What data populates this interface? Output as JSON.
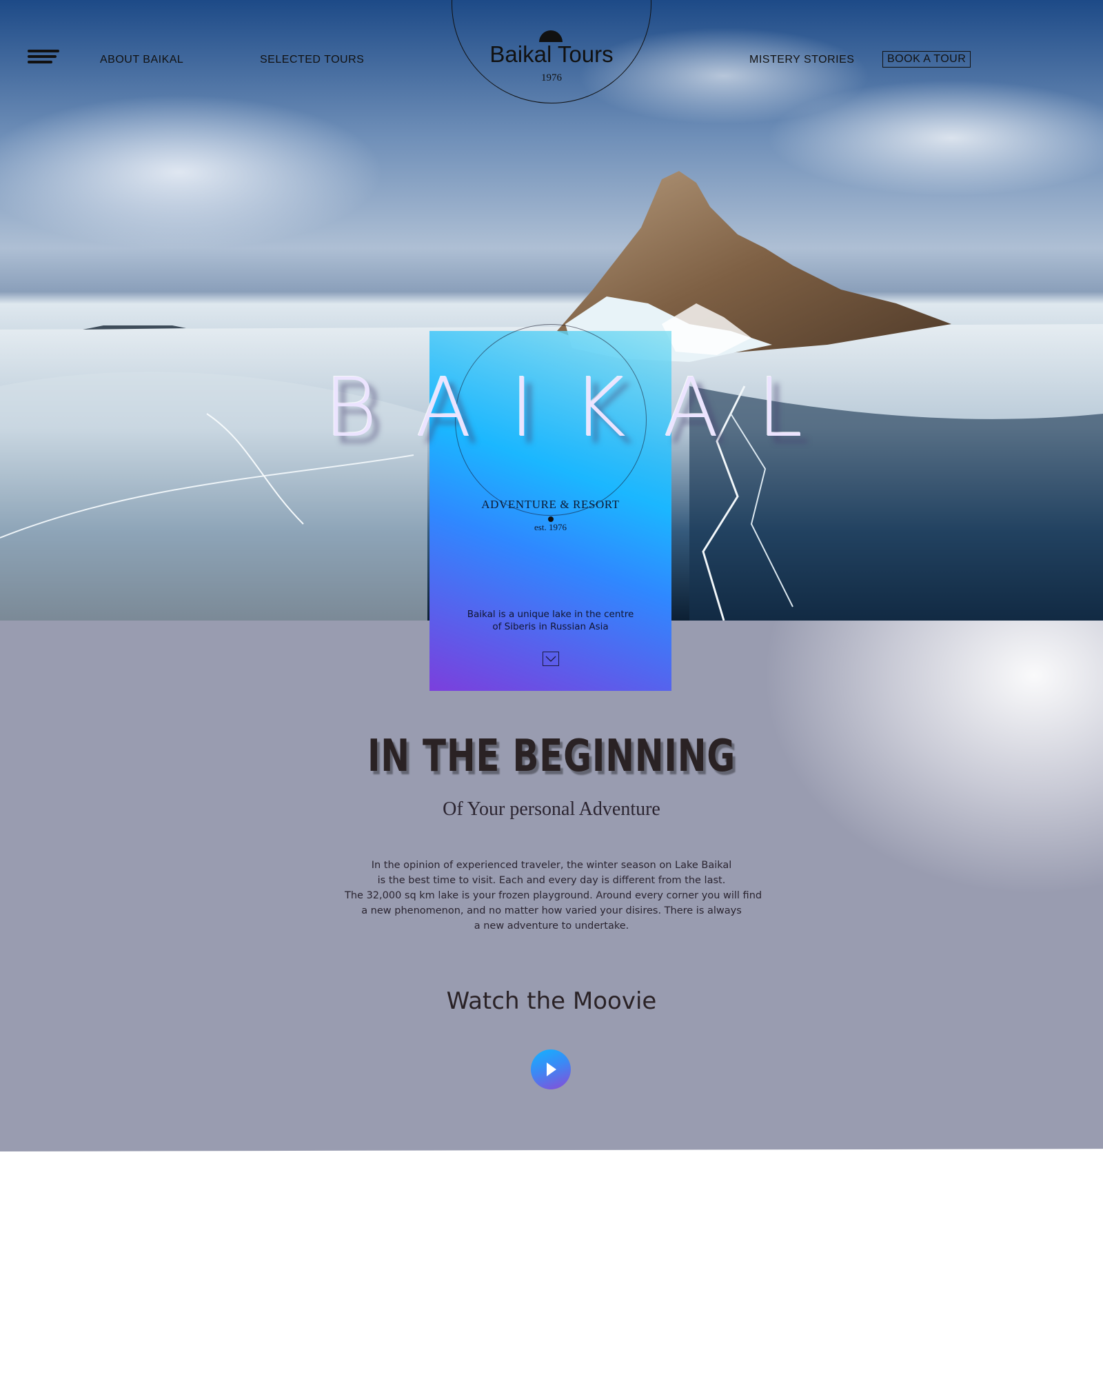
{
  "nav": {
    "menu_icon": "hamburger-menu-icon",
    "about": "ABOUT BAIKAL",
    "tours": "SELECTED TOURS",
    "stories": "MISTERY STORIES",
    "book": "BOOK A TOUR"
  },
  "logo": {
    "title": "Baikal Tours",
    "year": "1976"
  },
  "hero": {
    "big_title": "BAIKAL",
    "subtitle": "ADVENTURE & RESORT",
    "est": "est. 1976",
    "desc_line1": "Baikal is a unique lake in the centre",
    "desc_line2": "of Siberis in Russian Asia",
    "scroll_icon": "chevron-down-icon"
  },
  "intro": {
    "title": "IN THE BEGINNING",
    "subtitle": "Of Your personal Adventure",
    "body_lines": [
      "In the opinion of experienced traveler, the winter season on Lake Baikal",
      "is the best time to visit. Each and every day is different from the last.",
      "The 32,000 sq km lake is your frozen playground. Around every corner you will find",
      "a new phenomenon, and no matter how varied your disires. There is always",
      "a new adventure to undertake."
    ]
  },
  "movie": {
    "title": "Watch the Moovie",
    "play_icon": "play-icon"
  },
  "colors": {
    "card_top": "#1bb7ff",
    "card_bottom": "#7b3fdc",
    "section_bg": "#999cb0",
    "text_dark": "#111111"
  }
}
